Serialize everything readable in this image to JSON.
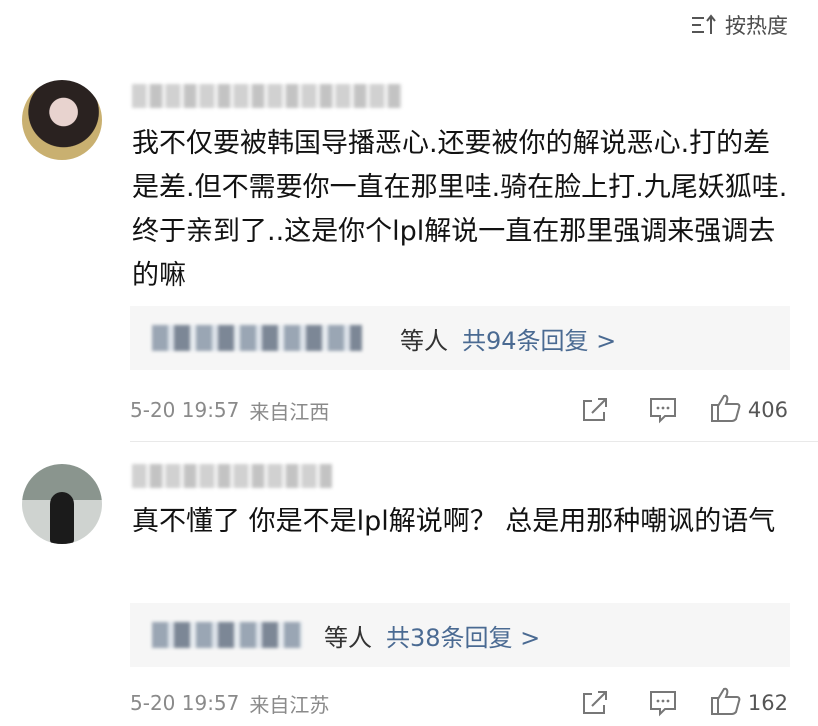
{
  "sort": {
    "label": "按热度",
    "icon": "sort-icon"
  },
  "comments": [
    {
      "text": "我不仅要被韩国导播恶心.还要被你的解说恶心.打的差是差.但不需要你一直在那里哇.骑在脸上打.九尾妖狐哇.终于亲到了..这是你个lpl解说一直在那里强调来强调去的嘛",
      "reply_who": "等人",
      "reply_count": "共94条回复 >",
      "time": "5-20 19:57",
      "location": "来自江西",
      "likes": "406"
    },
    {
      "text": "真不懂了 你是不是lpl解说啊？ 总是用那种嘲讽的语气",
      "reply_who": "等人",
      "reply_count": "共38条回复 >",
      "time": "5-20 19:57",
      "location": "来自江苏",
      "likes": "162"
    }
  ]
}
